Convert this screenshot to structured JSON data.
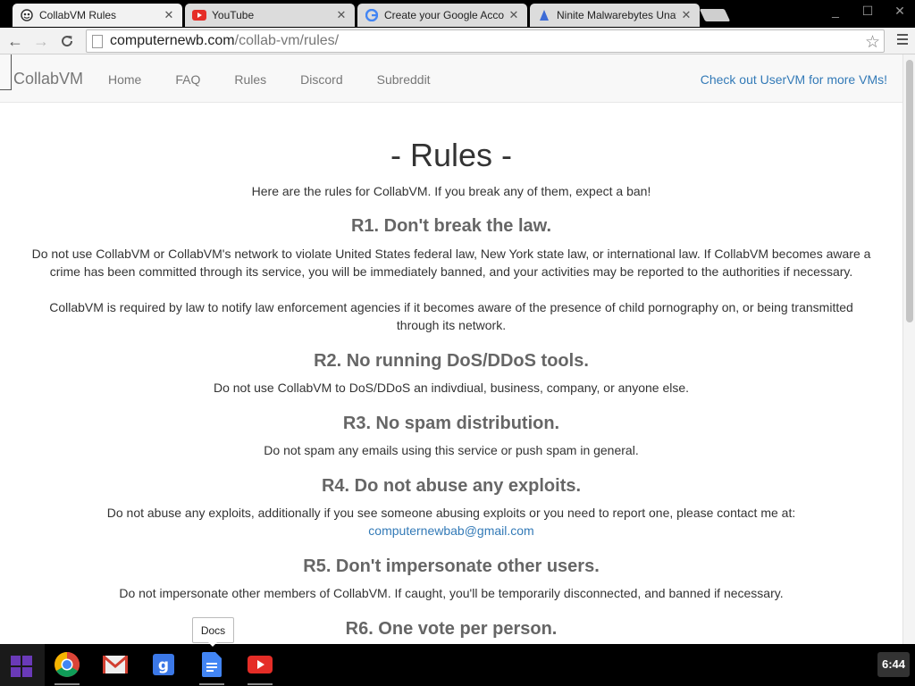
{
  "tabs": [
    {
      "label": "CollabVM Rules",
      "icon": "collabvm-icon",
      "active": true
    },
    {
      "label": "YouTube",
      "icon": "youtube-icon",
      "active": false
    },
    {
      "label": "Create your Google Acco",
      "icon": "google-icon",
      "active": false
    },
    {
      "label": "Ninite Malwarebytes Unat",
      "icon": "ninite-icon",
      "active": false
    }
  ],
  "address": {
    "host": "computernewb.com",
    "path": "/collab-vm/rules/"
  },
  "site": {
    "brand": "CollabVM",
    "nav": [
      "Home",
      "FAQ",
      "Rules",
      "Discord",
      "Subreddit"
    ],
    "promo": "Check out UserVM for more VMs!"
  },
  "page": {
    "title": "- Rules -",
    "intro": "Here are the rules for CollabVM. If you break any of them, expect a ban!",
    "rules": [
      {
        "heading": "R1. Don't break the law.",
        "paragraphs": [
          "Do not use CollabVM or CollabVM's network to violate United States federal law, New York state law, or international law. If CollabVM becomes aware a crime has been committed through its service, you will be immediately banned, and your activities may be reported to the authorities if necessary.",
          "CollabVM is required by law to notify law enforcement agencies if it becomes aware of the presence of child pornography on, or being transmitted through its network."
        ]
      },
      {
        "heading": "R2. No running DoS/DDoS tools.",
        "paragraphs": [
          "Do not use CollabVM to DoS/DDoS an indivdiual, business, company, or anyone else."
        ]
      },
      {
        "heading": "R3. No spam distribution.",
        "paragraphs": [
          "Do not spam any emails using this service or push spam in general."
        ]
      },
      {
        "heading": "R4. Do not abuse any exploits.",
        "paragraphs": [
          "Do not abuse any exploits, additionally if you see someone abusing exploits or you need to report one, please contact me at:"
        ],
        "email": "computernewbab@gmail.com"
      },
      {
        "heading": "R5. Don't impersonate other users.",
        "paragraphs": [
          "Do not impersonate other members of CollabVM. If caught, you'll be temporarily disconnected, and banned if necessary."
        ]
      },
      {
        "heading": "R6. One vote per person.",
        "paragraphs": []
      }
    ]
  },
  "shelf": {
    "apps": [
      "chrome-icon",
      "gmail-icon",
      "google-search-icon",
      "docs-icon",
      "youtube-icon"
    ],
    "tooltip": "Docs",
    "clock": "6:44"
  },
  "colors": {
    "link": "#337ab7",
    "heading": "#666666",
    "launcher": "#6a3ab8"
  }
}
